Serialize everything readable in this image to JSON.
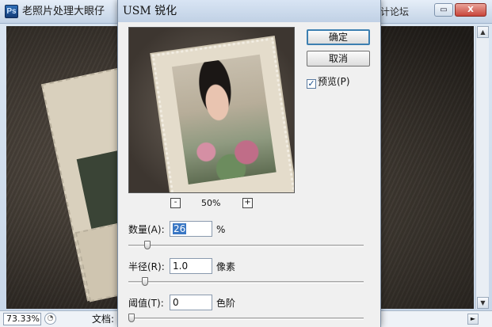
{
  "app": {
    "logo": "Ps",
    "tabs": [
      {
        "label": "老照片处理"
      },
      {
        "label": "大眼仔"
      }
    ],
    "watermark": "思缘设计论坛",
    "window_buttons": {
      "restore": "▭",
      "close": "X"
    }
  },
  "status": {
    "zoom": "73.33%",
    "doc_label": "文档:"
  },
  "dialog": {
    "title": "USM 锐化",
    "preview_zoom": "50%",
    "zoom_out": "-",
    "zoom_in": "+",
    "ok_label": "确定",
    "cancel_label": "取消",
    "preview_label": "预览(P)",
    "preview_checked": true,
    "params": {
      "amount": {
        "label": "数量(A):",
        "value": "26",
        "unit": "%",
        "slider_fraction": 0.07
      },
      "radius": {
        "label": "半径(R):",
        "value": "1.0",
        "unit": "像素",
        "slider_fraction": 0.06
      },
      "threshold": {
        "label": "阈值(T):",
        "value": "0",
        "unit": "色阶",
        "slider_fraction": 0.0
      }
    }
  },
  "colors": {
    "accent": "#3c7fb1",
    "selection": "#3a77c4"
  }
}
